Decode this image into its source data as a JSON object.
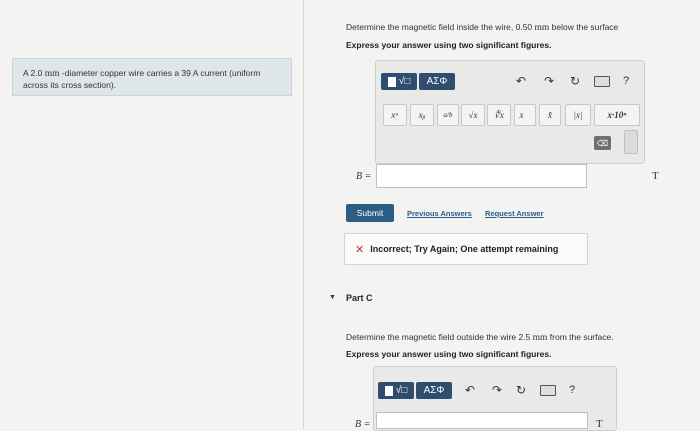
{
  "problem": {
    "text_before": "A 2.0 ",
    "unit": "mm",
    "text_after": " -diameter copper wire carries a 39 A current (uniform across its cross section)."
  },
  "part_b": {
    "question_before": "Determine the magnetic field inside the wire, 0.50 ",
    "question_unit": "mm",
    "question_after": " below the surface",
    "instruction": "Express your answer using two significant figures.",
    "answer_label": "B =",
    "answer_value": "",
    "unit": "T",
    "submit_label": "Submit",
    "previous_answers_label": "Previous Answers",
    "request_answer_label": "Request Answer",
    "feedback": "Incorrect; Try Again; One attempt remaining"
  },
  "toolbar": {
    "greek_label": "ΑΣΦ",
    "help_label": "?",
    "symbols": [
      "xᵃ",
      "xᵦ",
      "a/b",
      "√x",
      "∜x",
      "x⃗",
      "x̂",
      "|x|",
      "x·10ⁿ"
    ]
  },
  "part_c": {
    "title": "Part C",
    "question_before": "Determine the magnetic field outside the wire 2.5 ",
    "question_unit": "mm",
    "question_after": " from the surface.",
    "instruction": "Express your answer using two significant figures.",
    "answer_label": "B =",
    "unit": "T"
  }
}
